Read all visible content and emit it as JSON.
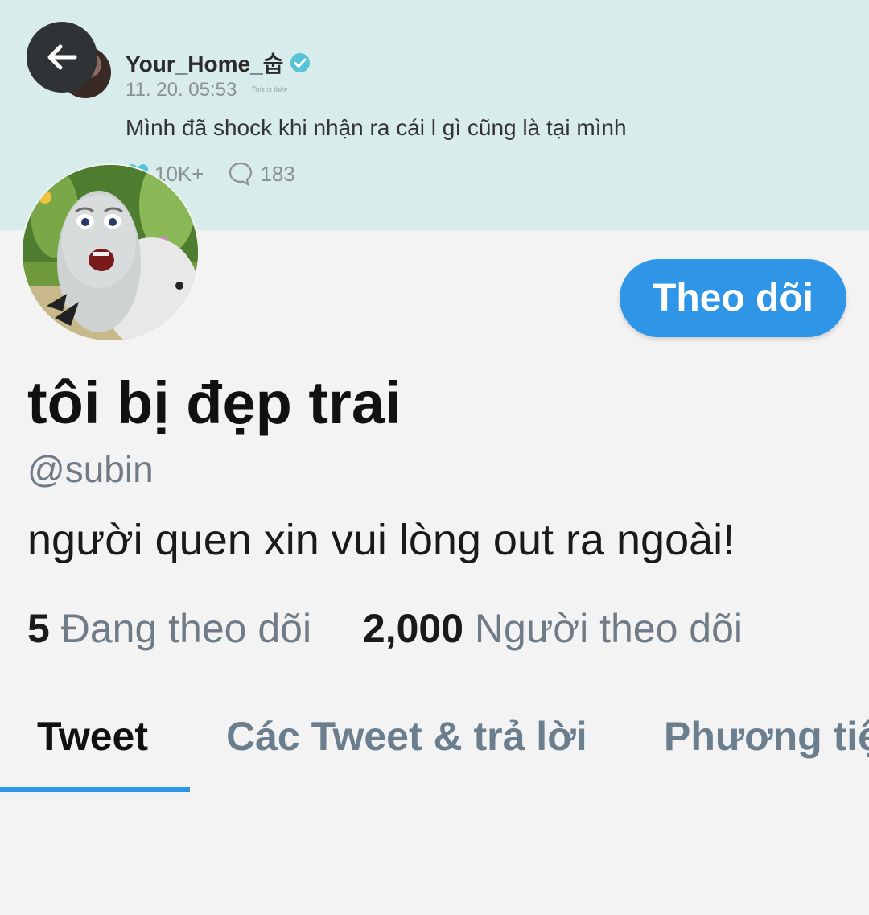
{
  "banner": {
    "username": "Your_Home_숩",
    "date": "11. 20. 05:53",
    "fake_note": "This is fake",
    "text": "Mình đã shock khi nhận ra cái l gì cũng là tại mình",
    "likes": "10K+",
    "replies": "183"
  },
  "profile": {
    "follow_label": "Theo dõi",
    "display_name": "tôi bị đẹp trai",
    "handle": "@subin",
    "bio": "người quen xin vui lòng out ra ngoài!",
    "following_count": "5",
    "following_label": "Đang theo dõi",
    "followers_count": "2,000",
    "followers_label": "Người theo dõi"
  },
  "tabs": [
    {
      "label": "Tweet"
    },
    {
      "label": "Các Tweet & trả lời"
    },
    {
      "label": "Phương tiện"
    }
  ],
  "colors": {
    "accent": "#2f95e6",
    "banner_bg": "#d8ecec",
    "secondary_text": "#6f7b86"
  },
  "icons": [
    "back-arrow-icon",
    "verified-icon",
    "heart-icon",
    "reply-bubble-icon"
  ]
}
